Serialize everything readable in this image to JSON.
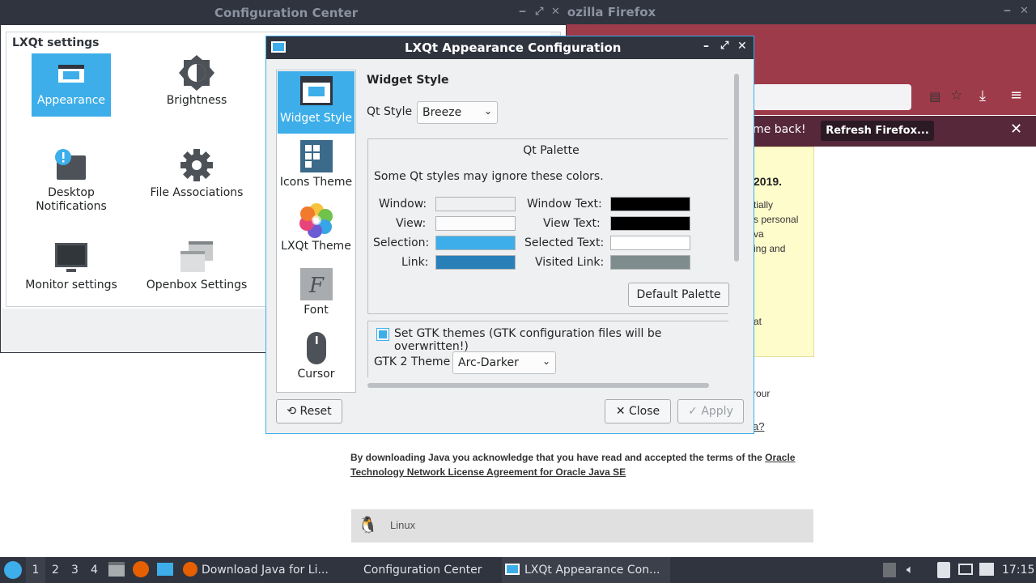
{
  "firefox": {
    "title": "Mozilla Firefox",
    "notice_text": "me back!",
    "refresh_label": "Refresh Firefox...",
    "yellow_heading": "2019.",
    "yellow_lines": [
      "tially",
      "s personal",
      "va",
      "ing and",
      "at"
    ],
    "partial_lines": [
      "rour",
      "a?"
    ],
    "ack_text": "By downloading Java you acknowledge that you have read and accepted the terms of the ",
    "ack_link": "Oracle Technology Network License Agreement for Oracle Java SE",
    "linux_label": "Linux"
  },
  "config_center": {
    "title": "Configuration Center",
    "section_label": "LXQt settings",
    "items": [
      {
        "label": "Appearance",
        "icon": "appearance-icon"
      },
      {
        "label": "Brightness",
        "icon": "brightness-icon"
      },
      {
        "label": "Desktop Notifications",
        "icon": "notifications-icon"
      },
      {
        "label": "File Associations",
        "icon": "gear-icon"
      },
      {
        "label": "Monitor settings",
        "icon": "monitor-icon"
      },
      {
        "label": "Openbox Settings",
        "icon": "windows-icon"
      }
    ]
  },
  "dialog": {
    "title": "LXQt Appearance Configuration",
    "sidebar": [
      {
        "label": "Widget Style",
        "icon": "widget-style-icon"
      },
      {
        "label": "Icons Theme",
        "icon": "icons-theme-icon"
      },
      {
        "label": "LXQt Theme",
        "icon": "lxqt-theme-icon"
      },
      {
        "label": "Font",
        "icon": "font-icon"
      },
      {
        "label": "Cursor",
        "icon": "mouse-icon"
      }
    ],
    "page_title": "Widget Style",
    "qt_style_label": "Qt Style",
    "qt_style_value": "Breeze",
    "palette_title": "Qt Palette",
    "palette_note": "Some Qt styles may ignore these colors.",
    "palette": {
      "window_label": "Window:",
      "view_label": "View:",
      "selection_label": "Selection:",
      "link_label": "Link:",
      "window_text_label": "Window Text:",
      "view_text_label": "View Text:",
      "selected_text_label": "Selected Text:",
      "visited_link_label": "Visited Link:",
      "colors": {
        "window": "#eff0f1",
        "view": "#fcfcfc",
        "selection": "#3daee9",
        "link": "#2980b9",
        "window_text": "#000000",
        "view_text": "#000000",
        "selected_text": "#ffffff",
        "visited_link": "#7f8c8d"
      }
    },
    "default_palette_label": "Default Palette",
    "gtk_checkbox_label": "Set GTK themes (GTK configuration files will be overwritten!)",
    "gtk_checked": true,
    "gtk2_label": "GTK 2 Theme",
    "gtk2_value": "Arc-Darker",
    "reset_label": "Reset",
    "close_label": "Close",
    "apply_label": "Apply"
  },
  "taskbar": {
    "desktops": [
      "1",
      "2",
      "3",
      "4"
    ],
    "tasks": [
      "Download Java for Li...",
      "Configuration Center",
      "LXQt Appearance Con..."
    ],
    "clock": "17:15"
  }
}
